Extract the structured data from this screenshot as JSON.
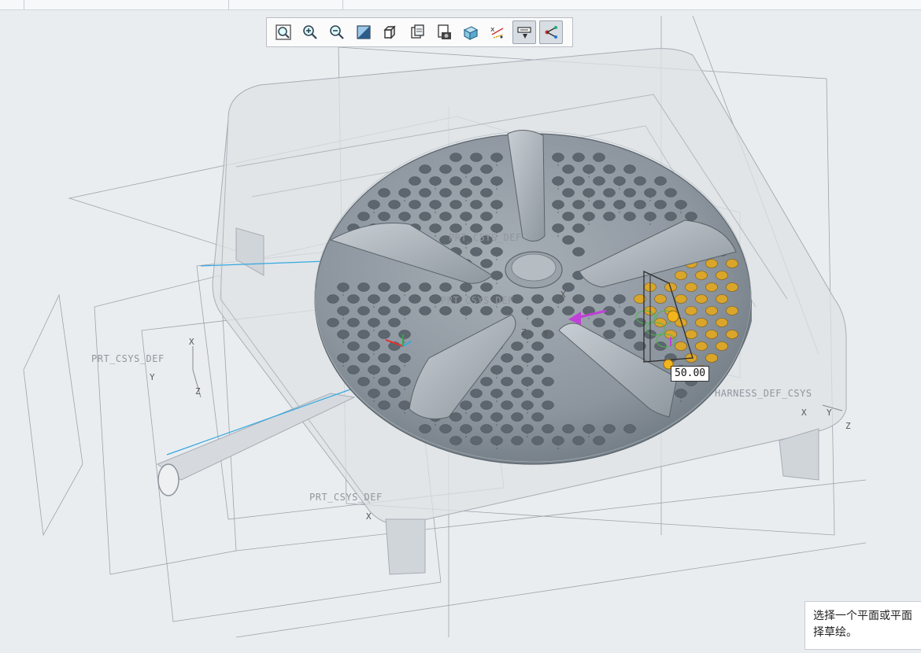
{
  "toolbar": {
    "buttons": [
      {
        "name": "refit-icon",
        "active": false
      },
      {
        "name": "zoom-in-icon",
        "active": false
      },
      {
        "name": "zoom-out-icon",
        "active": false
      },
      {
        "name": "repaint-icon",
        "active": false
      },
      {
        "name": "display-style-icon",
        "active": false
      },
      {
        "name": "saved-orientation-icon",
        "active": false
      },
      {
        "name": "view-manager-icon",
        "active": false
      },
      {
        "name": "perspective-view-icon",
        "active": false
      },
      {
        "name": "datum-display-icon",
        "active": false
      },
      {
        "name": "annotation-display-icon",
        "active": true
      },
      {
        "name": "spin-center-icon",
        "active": true
      }
    ]
  },
  "model": {
    "csys_labels": [
      "PRT_CSYS_DEF",
      "PRT_CSYS_DEF",
      "PRT_CSYS_DEF",
      "PRT_CSYS_DEF",
      "HARNESS_DEF_CSYS"
    ],
    "axis_labels": [
      "X",
      "Y",
      "Z",
      "X",
      "Y",
      "Z",
      "X",
      "Z",
      "Y",
      "X"
    ],
    "dimension_value": "50.00"
  },
  "message_area": {
    "line1": "选择一个平面或平面",
    "line2": "择草绘。"
  },
  "colors": {
    "background": "#eaedf0",
    "disk": "#8a939c",
    "highlight_hole": "#d9a52b",
    "sketch_circle": "#4fb34f",
    "datum_blue": "#36a8e0",
    "drag_arrow": "#c040d8"
  }
}
